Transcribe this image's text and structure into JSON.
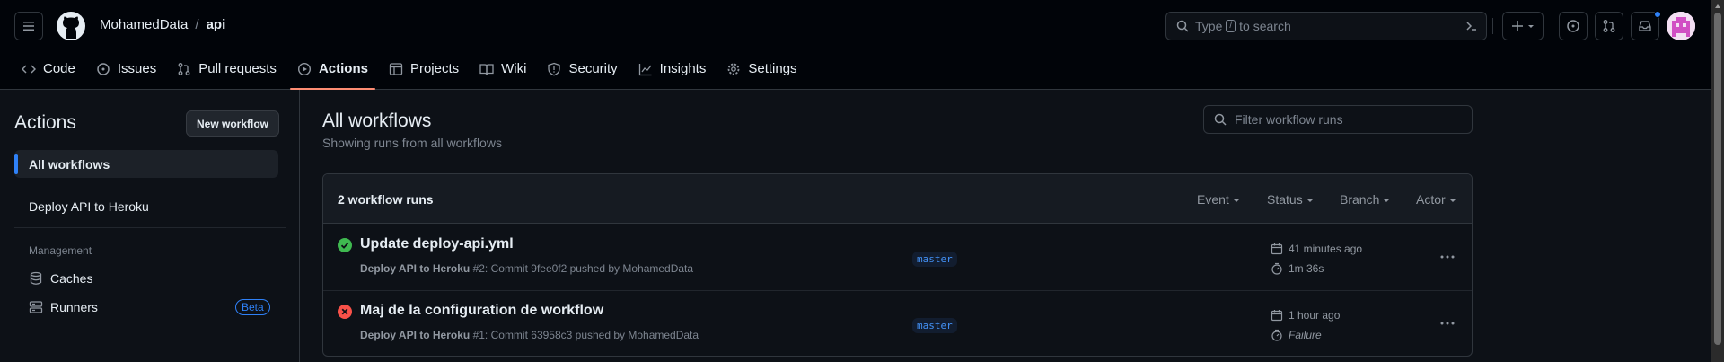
{
  "header": {
    "owner": "MohamedData",
    "separator": "/",
    "repo": "api",
    "search_prefix": "Type",
    "search_key": "/",
    "search_suffix": "to search"
  },
  "nav": {
    "tabs": [
      {
        "label": "Code",
        "icon": "code-icon"
      },
      {
        "label": "Issues",
        "icon": "issue-icon"
      },
      {
        "label": "Pull requests",
        "icon": "pull-request-icon"
      },
      {
        "label": "Actions",
        "icon": "play-icon",
        "active": true
      },
      {
        "label": "Projects",
        "icon": "table-icon"
      },
      {
        "label": "Wiki",
        "icon": "book-icon"
      },
      {
        "label": "Security",
        "icon": "shield-icon"
      },
      {
        "label": "Insights",
        "icon": "graph-icon"
      },
      {
        "label": "Settings",
        "icon": "gear-icon"
      }
    ]
  },
  "sidebar": {
    "title": "Actions",
    "new_workflow": "New workflow",
    "all_workflows": "All workflows",
    "workflow": "Deploy API to Heroku",
    "management_heading": "Management",
    "caches": "Caches",
    "runners": "Runners",
    "beta_badge": "Beta"
  },
  "main": {
    "title": "All workflows",
    "subtitle": "Showing runs from all workflows",
    "filter_placeholder": "Filter workflow runs",
    "runs_count": "2 workflow runs",
    "filters": [
      "Event",
      "Status",
      "Branch",
      "Actor"
    ],
    "runs": [
      {
        "title": "Update deploy-api.yml",
        "workflow": "Deploy API to Heroku",
        "detail": " #2: Commit 9fee0f2 pushed by MohamedData",
        "branch": "master",
        "when": "41 minutes ago",
        "duration": "1m 36s",
        "status": "success"
      },
      {
        "title": "Maj de la configuration de workflow",
        "workflow": "Deploy API to Heroku",
        "detail": " #1: Commit 63958c3 pushed by MohamedData",
        "branch": "master",
        "when": "1 hour ago",
        "duration": "Failure",
        "status": "failure"
      }
    ]
  },
  "colors": {
    "background": "#0d1117",
    "header_bg": "#010409",
    "accent_tab": "#fd8c73",
    "link_blue": "#2f81f7",
    "success": "#3fb950",
    "failure": "#f85149"
  }
}
